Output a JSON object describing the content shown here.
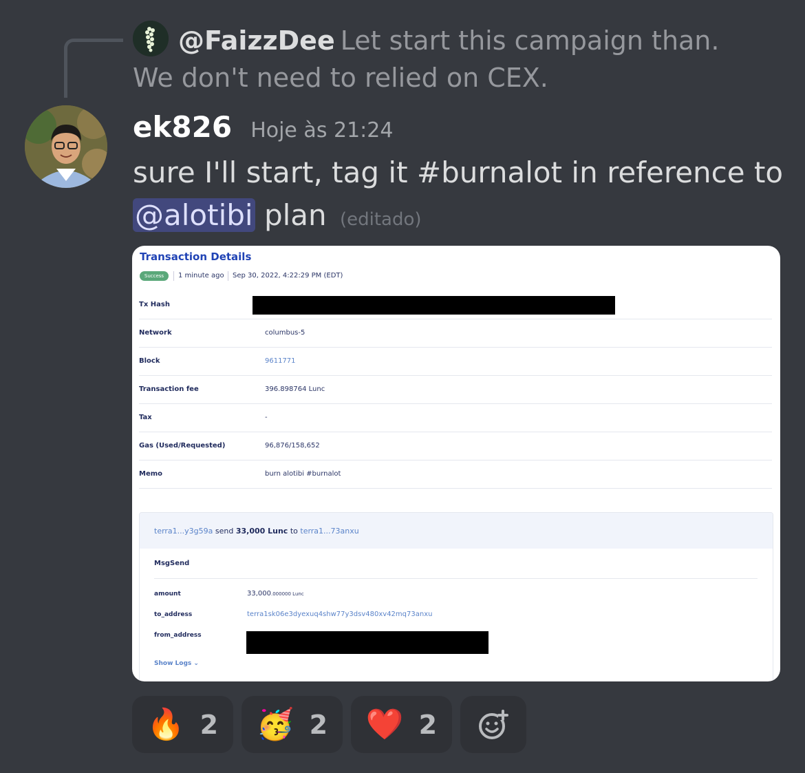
{
  "reply": {
    "username": "@FaizzDee",
    "text": "Let start this campaign than. We don't need to relied on CEX."
  },
  "message": {
    "username": "ek826",
    "timestamp": "Hoje às 21:24",
    "text_before": "sure I'll start, tag it #burnalot in reference to",
    "mention": "@alotibi",
    "text_after": "plan",
    "edited": "(editado)"
  },
  "embed": {
    "title": "Transaction Details",
    "status": "Success",
    "age": "1 minute ago",
    "datetime": "Sep 30, 2022, 4:22:29 PM (EDT)",
    "rows": [
      {
        "label": "Tx Hash",
        "value": ""
      },
      {
        "label": "Network",
        "value": "columbus-5"
      },
      {
        "label": "Block",
        "value": "9611771"
      },
      {
        "label": "Transaction fee",
        "value": "396.898764 Lunc"
      },
      {
        "label": "Tax",
        "value": "-"
      },
      {
        "label": "Gas (Used/Requested)",
        "value": "96,876/158,652"
      },
      {
        "label": "Memo",
        "value": "burn alotibi #burnalot"
      }
    ],
    "msg": {
      "from_short": "terra1...y3g59a",
      "send_word": "send",
      "amount_text": "33,000 Lunc",
      "to_word": "to",
      "to_short": "terra1...73anxu",
      "type": "MsgSend",
      "amount_label": "amount",
      "amount_main": "33,000",
      "amount_decimals": ".000000 Lunc",
      "to_address_label": "to_address",
      "to_address": "terra1sk06e3dyexuq4shw77y3dsv480xv42mq73anxu",
      "from_address_label": "from_address",
      "show_logs": "Show Logs ⌄"
    }
  },
  "reactions": [
    {
      "emoji": "🔥",
      "icon": "fire-icon",
      "count": "2"
    },
    {
      "emoji": "🥳",
      "icon": "partying-face-icon",
      "count": "2"
    },
    {
      "emoji": "❤️",
      "icon": "heart-icon",
      "count": "2"
    }
  ]
}
